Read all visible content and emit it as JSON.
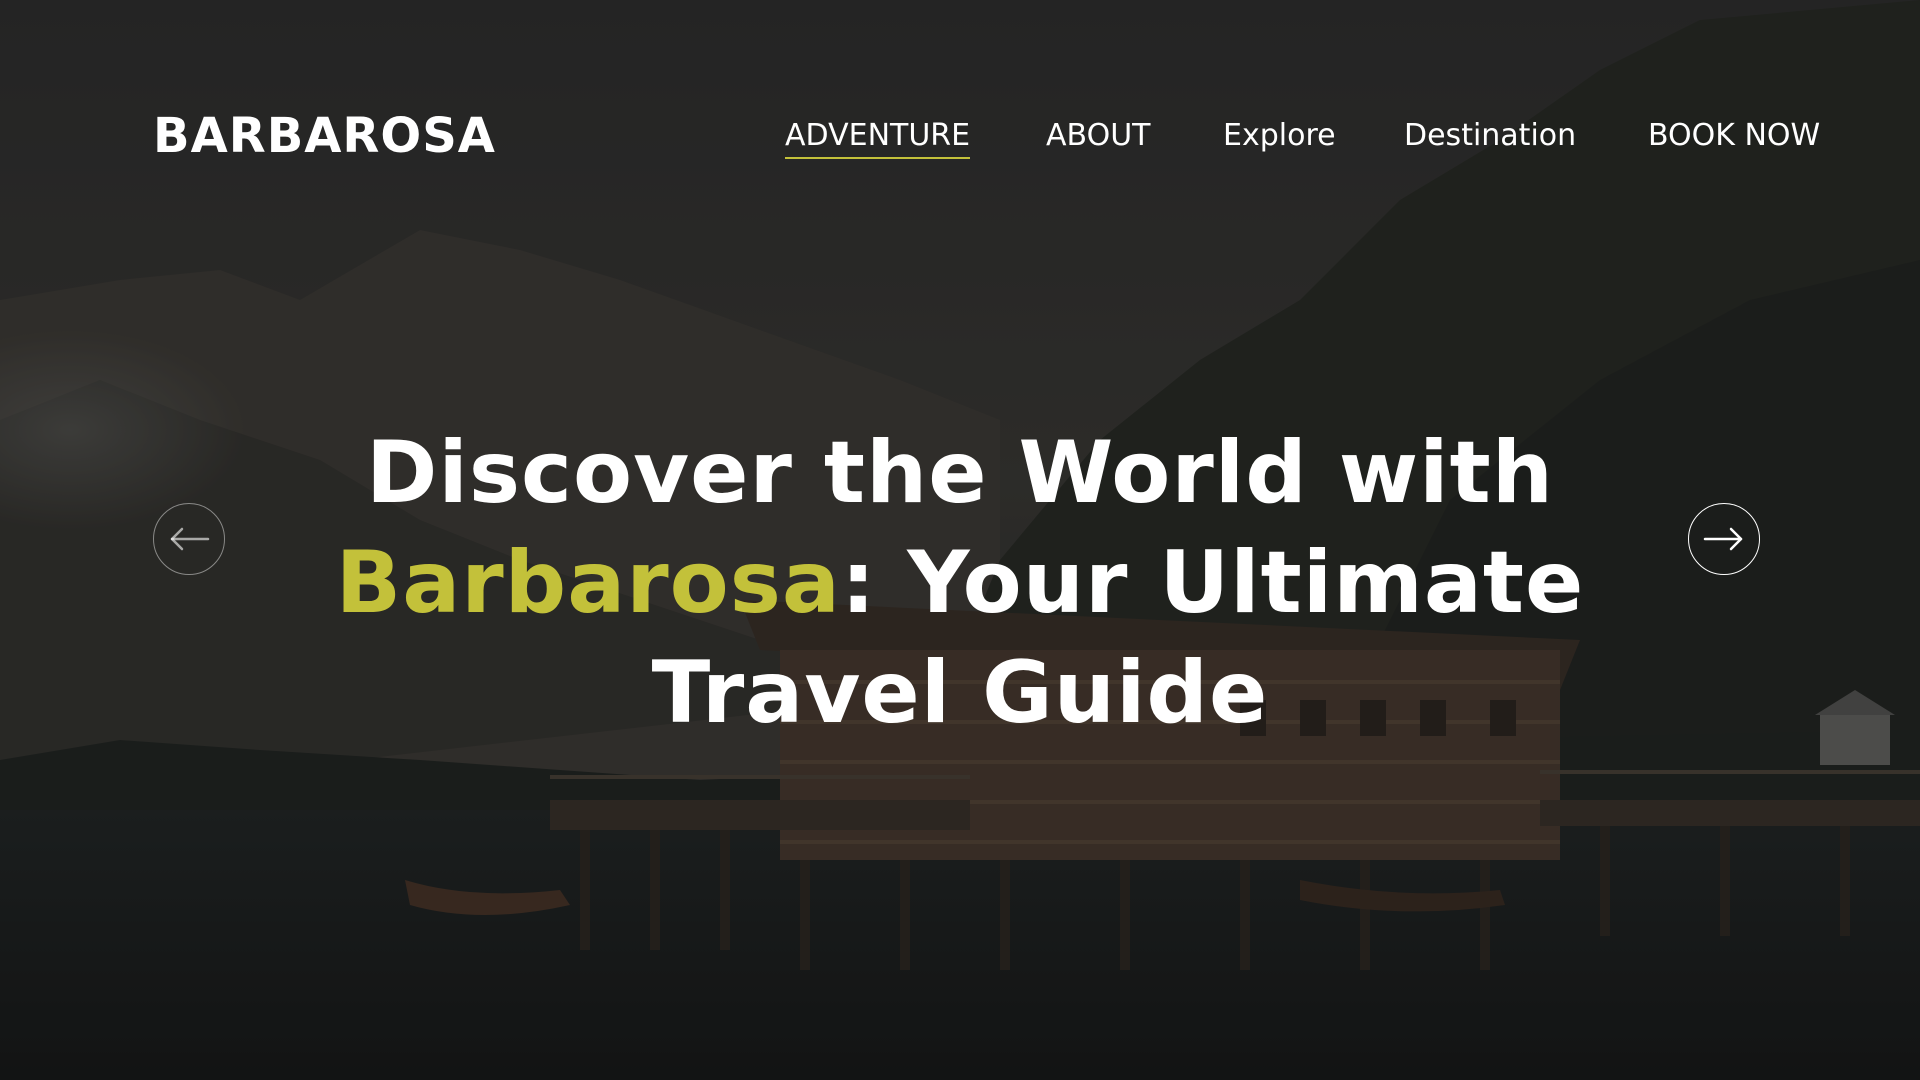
{
  "brand": {
    "name": "BARBAROSA"
  },
  "nav": {
    "items": [
      {
        "label": "ADVENTURE",
        "active": true
      },
      {
        "label": "ABOUT",
        "active": false
      },
      {
        "label": "Explore",
        "active": false
      },
      {
        "label": "Destination",
        "active": false
      },
      {
        "label": "BOOK NOW",
        "active": false
      }
    ]
  },
  "hero": {
    "line1": "Discover the World with",
    "highlight": "Barbarosa",
    "line2_rest": ": Your Ultimate",
    "line3": "Travel Guide"
  },
  "carousel": {
    "prev_icon": "arrow-left-icon",
    "next_icon": "arrow-right-icon"
  },
  "colors": {
    "accent": "#c3c13a",
    "text": "#ffffff",
    "background": "#1f1f1f"
  }
}
